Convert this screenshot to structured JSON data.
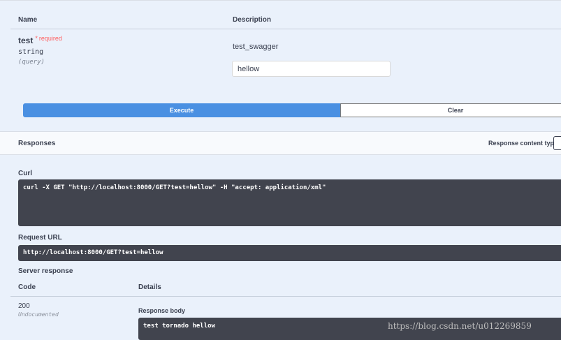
{
  "params_table": {
    "col_name": "Name",
    "col_description": "Description"
  },
  "parameter": {
    "name": "test",
    "required_star": "*",
    "required_label": "required",
    "type": "string",
    "location": "(query)",
    "description": "test_swagger",
    "value": "hellow"
  },
  "actions": {
    "execute": "Execute",
    "clear": "Clear"
  },
  "responses": {
    "title": "Responses",
    "content_type_label": "Response content type",
    "curl_label": "Curl",
    "curl": "curl -X GET \"http://localhost:8000/GET?test=hellow\" -H \"accept: application/xml\"",
    "request_url_label": "Request URL",
    "request_url": "http://localhost:8000/GET?test=hellow",
    "server_response_label": "Server response",
    "col_code": "Code",
    "col_details": "Details",
    "code": "200",
    "code_note": "Undocumented",
    "body_label": "Response body",
    "body": "test tornado hellow"
  },
  "watermark": "https://blog.csdn.net/u012269859",
  "colors": {
    "background": "#eaf1fb",
    "execute_bg": "#4a90e2",
    "code_bg": "#41444e",
    "required": "#ff6060"
  }
}
